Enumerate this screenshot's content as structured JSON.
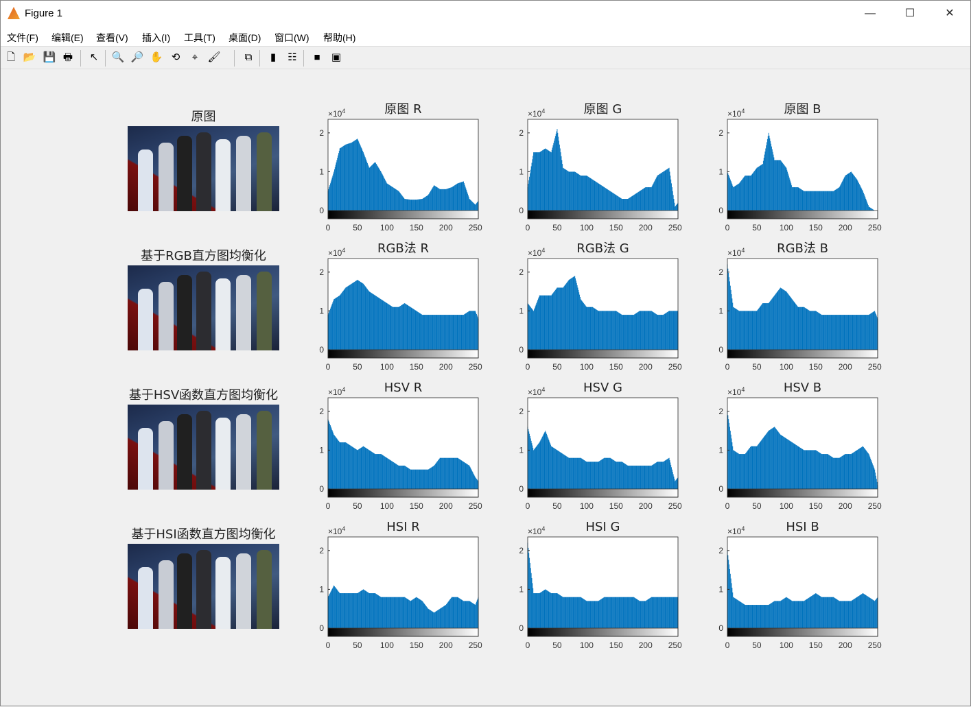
{
  "window": {
    "title": "Figure 1",
    "minimize": "—",
    "maximize": "☐",
    "close": "✕"
  },
  "menu": [
    "文件(F)",
    "编辑(E)",
    "查看(V)",
    "插入(I)",
    "工具(T)",
    "桌面(D)",
    "窗口(W)",
    "帮助(H)"
  ],
  "toolbar": [
    {
      "icon": "new-file-icon",
      "glyph": "🗋"
    },
    {
      "icon": "open-folder-icon",
      "glyph": "📂"
    },
    {
      "icon": "save-icon",
      "glyph": "💾"
    },
    {
      "icon": "print-icon",
      "glyph": "🖶"
    },
    {
      "icon": "pointer-icon",
      "glyph": "↖"
    },
    {
      "icon": "zoom-in-icon",
      "glyph": "🔍"
    },
    {
      "icon": "zoom-out-icon",
      "glyph": "🔎"
    },
    {
      "icon": "pan-hand-icon",
      "glyph": "✋"
    },
    {
      "icon": "rotate-3d-icon",
      "glyph": "⟲"
    },
    {
      "icon": "data-cursor-icon",
      "glyph": "⌖"
    },
    {
      "icon": "brush-icon",
      "glyph": "🖌"
    },
    {
      "icon": "link-plot-icon",
      "glyph": "⧉"
    },
    {
      "icon": "colorbar-icon",
      "glyph": "▮"
    },
    {
      "icon": "legend-icon",
      "glyph": "☷"
    },
    {
      "icon": "hide-plot-tools-icon",
      "glyph": "■"
    },
    {
      "icon": "show-plot-tools-icon",
      "glyph": "▣"
    }
  ],
  "image_titles": [
    "原图",
    "基于RGB直方图均衡化",
    "基于HSV函数直方图均衡化",
    "基于HSI函数直方图均衡化"
  ],
  "bar_color": "#0072BD",
  "chart_data": {
    "type": "bar",
    "x": [
      0,
      10,
      20,
      30,
      40,
      50,
      60,
      70,
      80,
      90,
      100,
      110,
      120,
      130,
      140,
      150,
      160,
      170,
      180,
      190,
      200,
      210,
      220,
      230,
      240,
      250,
      255
    ],
    "xlim": [
      0,
      255
    ],
    "ylim": [
      0,
      2.35
    ],
    "xticks": [
      0,
      50,
      100,
      150,
      200,
      250
    ],
    "yticks": [
      0,
      1,
      2
    ],
    "y_exponent": "×10",
    "y_exponent_power": "4",
    "grid": false,
    "charts": [
      {
        "title": "原图 R",
        "values": [
          0.5,
          1.0,
          1.6,
          1.7,
          1.75,
          1.85,
          1.5,
          1.1,
          1.25,
          1.0,
          0.7,
          0.6,
          0.5,
          0.3,
          0.28,
          0.28,
          0.3,
          0.4,
          0.65,
          0.55,
          0.55,
          0.6,
          0.7,
          0.75,
          0.3,
          0.15,
          0.25
        ]
      },
      {
        "title": "原图 G",
        "values": [
          0.6,
          1.5,
          1.5,
          1.6,
          1.5,
          2.1,
          1.1,
          1.0,
          1.0,
          0.9,
          0.9,
          0.8,
          0.7,
          0.6,
          0.5,
          0.4,
          0.3,
          0.3,
          0.4,
          0.5,
          0.6,
          0.6,
          0.9,
          1.0,
          1.1,
          0.1,
          0.2
        ]
      },
      {
        "title": "原图 B",
        "values": [
          1.0,
          0.6,
          0.7,
          0.9,
          0.9,
          1.1,
          1.2,
          2.0,
          1.3,
          1.3,
          1.1,
          0.6,
          0.6,
          0.5,
          0.5,
          0.5,
          0.5,
          0.5,
          0.5,
          0.6,
          0.9,
          1.0,
          0.8,
          0.5,
          0.1,
          0,
          0
        ]
      },
      {
        "title": "RGB法 R",
        "values": [
          0.9,
          1.3,
          1.4,
          1.6,
          1.7,
          1.8,
          1.7,
          1.5,
          1.4,
          1.3,
          1.2,
          1.1,
          1.1,
          1.2,
          1.1,
          1.0,
          0.9,
          0.9,
          0.9,
          0.9,
          0.9,
          0.9,
          0.9,
          0.9,
          1.0,
          1.0,
          0.8
        ]
      },
      {
        "title": "RGB法 G",
        "values": [
          1.2,
          1.0,
          1.4,
          1.4,
          1.4,
          1.6,
          1.6,
          1.8,
          1.9,
          1.3,
          1.1,
          1.1,
          1.0,
          1.0,
          1.0,
          1.0,
          0.9,
          0.9,
          0.9,
          1.0,
          1.0,
          1.0,
          0.9,
          0.9,
          1.0,
          1.0,
          1.0
        ]
      },
      {
        "title": "RGB法 B",
        "values": [
          2.2,
          1.1,
          1.0,
          1.0,
          1.0,
          1.0,
          1.2,
          1.2,
          1.4,
          1.6,
          1.5,
          1.3,
          1.1,
          1.1,
          1.0,
          1.0,
          0.9,
          0.9,
          0.9,
          0.9,
          0.9,
          0.9,
          0.9,
          0.9,
          0.9,
          1.0,
          0.8
        ]
      },
      {
        "title": "HSV R",
        "values": [
          1.8,
          1.4,
          1.2,
          1.2,
          1.1,
          1.0,
          1.1,
          1.0,
          0.9,
          0.9,
          0.8,
          0.7,
          0.6,
          0.6,
          0.5,
          0.5,
          0.5,
          0.5,
          0.6,
          0.8,
          0.8,
          0.8,
          0.8,
          0.7,
          0.6,
          0.3,
          0.2
        ]
      },
      {
        "title": "HSV G",
        "values": [
          1.6,
          1.0,
          1.2,
          1.5,
          1.1,
          1.0,
          0.9,
          0.8,
          0.8,
          0.8,
          0.7,
          0.7,
          0.7,
          0.8,
          0.8,
          0.7,
          0.7,
          0.6,
          0.6,
          0.6,
          0.6,
          0.6,
          0.7,
          0.7,
          0.8,
          0.2,
          0.3
        ]
      },
      {
        "title": "HSV B",
        "values": [
          2.0,
          1.0,
          0.9,
          0.9,
          1.1,
          1.1,
          1.3,
          1.5,
          1.6,
          1.4,
          1.3,
          1.2,
          1.1,
          1.0,
          1.0,
          1.0,
          0.9,
          0.9,
          0.8,
          0.8,
          0.9,
          0.9,
          1.0,
          1.1,
          0.9,
          0.5,
          0.1
        ]
      },
      {
        "title": "HSI R",
        "values": [
          0.8,
          1.1,
          0.9,
          0.9,
          0.9,
          0.9,
          1.0,
          0.9,
          0.9,
          0.8,
          0.8,
          0.8,
          0.8,
          0.8,
          0.7,
          0.8,
          0.7,
          0.5,
          0.4,
          0.5,
          0.6,
          0.8,
          0.8,
          0.7,
          0.7,
          0.6,
          0.8
        ]
      },
      {
        "title": "HSI G",
        "values": [
          2.2,
          0.9,
          0.9,
          1.0,
          0.9,
          0.9,
          0.8,
          0.8,
          0.8,
          0.8,
          0.7,
          0.7,
          0.7,
          0.8,
          0.8,
          0.8,
          0.8,
          0.8,
          0.8,
          0.7,
          0.7,
          0.8,
          0.8,
          0.8,
          0.8,
          0.8,
          0.8
        ]
      },
      {
        "title": "HSI B",
        "values": [
          2.0,
          0.8,
          0.7,
          0.6,
          0.6,
          0.6,
          0.6,
          0.6,
          0.7,
          0.7,
          0.8,
          0.7,
          0.7,
          0.7,
          0.8,
          0.9,
          0.8,
          0.8,
          0.8,
          0.7,
          0.7,
          0.7,
          0.8,
          0.9,
          0.8,
          0.7,
          0.8
        ]
      }
    ]
  }
}
